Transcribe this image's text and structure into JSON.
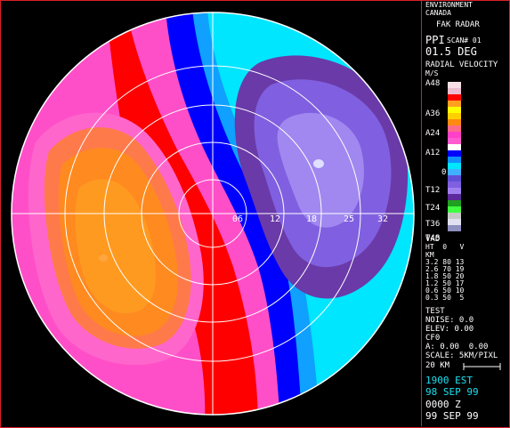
{
  "header": {
    "org_line1": "ENVIRONMENT",
    "org_line2": "CANADA",
    "radar_name": "FAK RADAR"
  },
  "scan": {
    "mode": "PPI",
    "scan_label": "SCAN# 01",
    "elevation": "01.5 DEG",
    "product_line1": "RADIAL VELOCITY",
    "product_line2": "M/S"
  },
  "legend": {
    "labels": [
      "A48",
      "A36",
      "A24",
      "A12",
      "0",
      "T12",
      "T24",
      "T36",
      "T48"
    ],
    "colors": [
      "#f6e0e6",
      "#ecbcd0",
      "#ff0000",
      "#ffa020",
      "#ffff00",
      "#ffd000",
      "#ff8a10",
      "#ff6a8a",
      "#ff40c8",
      "#ff5ad0",
      "#ffffff",
      "#0000ff",
      "#1090ff",
      "#00e6ff",
      "#40b0ff",
      "#6050d8",
      "#8060e0",
      "#a080f0",
      "#5c2a9a",
      "#20a020",
      "#40ff40",
      "#c8c8c8",
      "#e0e0f0",
      "#9090c0"
    ]
  },
  "vad": {
    "title": "VAD",
    "header_row": "HT  0   V",
    "unit": "KM",
    "rows": [
      "3.2 80 13",
      "2.6 70 19",
      "1.8 50 20",
      "1.2 50 17",
      "0.6 50 10",
      "0.3 50  5"
    ]
  },
  "test": {
    "title": "TEST",
    "noise": "NOISE: 0.0",
    "elev": "ELEV: 0.00",
    "cfo": "CF0",
    "a_line": "A: 0.00  0.00",
    "scale": "SCALE: 5KM/PIXL",
    "distance": "20 KM"
  },
  "time": {
    "local_time": "1900 EST",
    "local_date": "98 SEP 99",
    "utc_time": "0000 Z",
    "utc_date": "99 SEP 99"
  },
  "range_labels": [
    "06",
    "12",
    "18",
    "25",
    "32"
  ],
  "colors": {
    "frame": "#d8202a",
    "text_cyan": "#19e0f0",
    "red_band": "#ff0000",
    "pink_outer": "#ff4fc8",
    "pink_mid": "#ff66cc",
    "orange_rose": "#ff7a4a",
    "orange": "#ff8a20",
    "orange_core": "#ff9a20",
    "blue": "#0000ff",
    "light_blue": "#10a0ff",
    "cyan_band": "#00e6ff",
    "purple_outer": "#6a3aa8",
    "purple_mid": "#8060e0",
    "purple_core": "#a088f0",
    "rings": "#ffffff"
  }
}
